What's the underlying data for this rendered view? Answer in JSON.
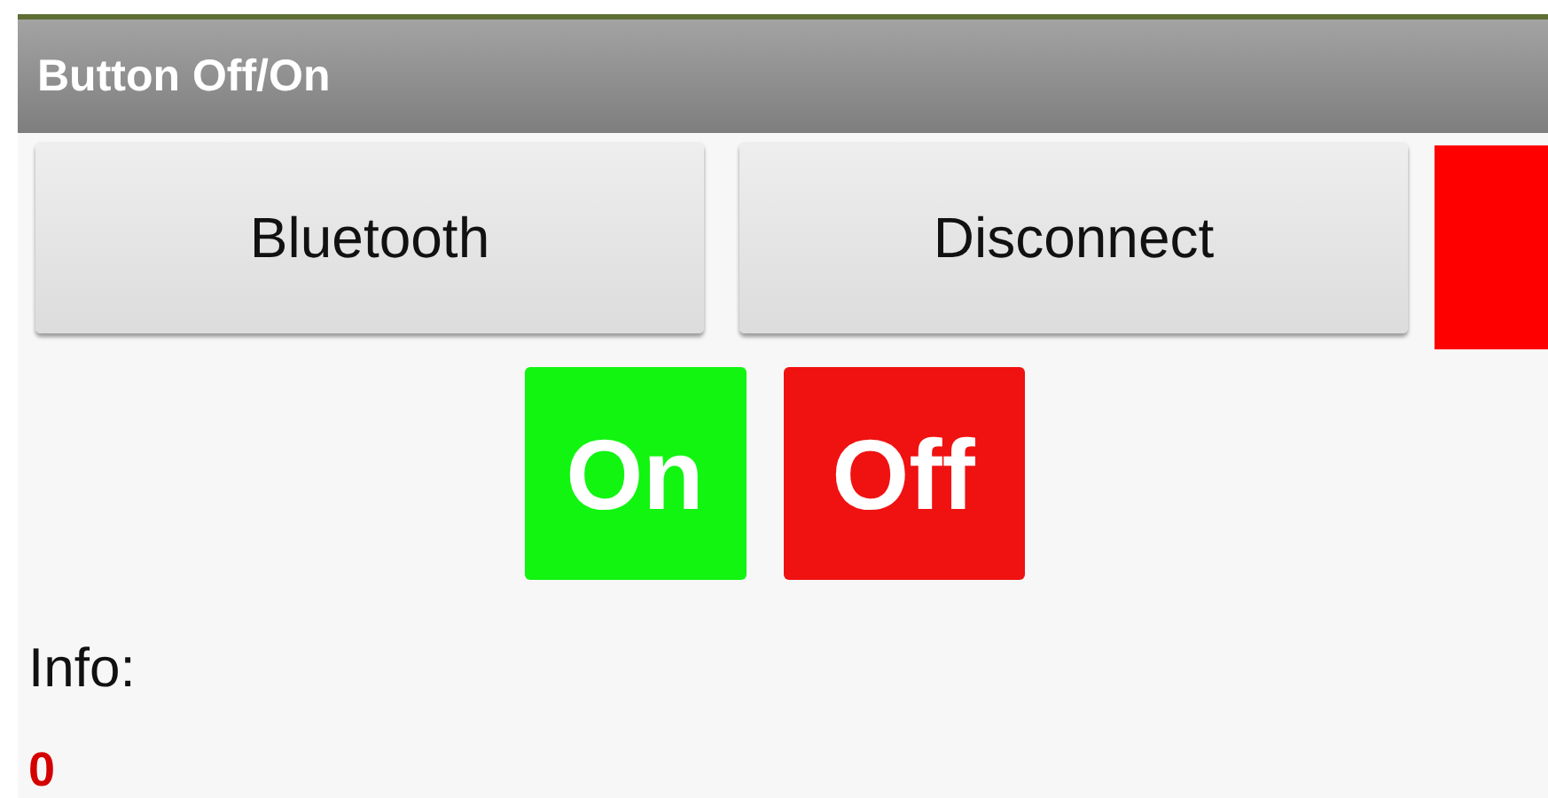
{
  "title_bar": {
    "title": "Button Off/On"
  },
  "top_buttons": [
    {
      "label": "Bluetooth"
    },
    {
      "label": "Disconnect"
    }
  ],
  "toggle_buttons": [
    {
      "label": "On",
      "kind": "on"
    },
    {
      "label": "Off",
      "kind": "off"
    }
  ],
  "info_label": "Info:",
  "info_value": "0"
}
